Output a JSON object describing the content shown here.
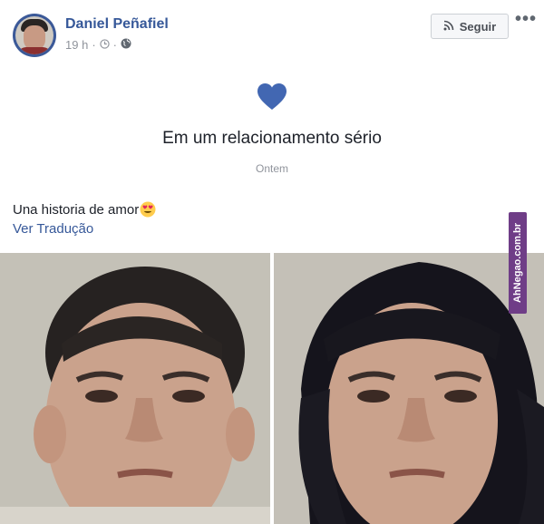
{
  "post": {
    "author": "Daniel Peñafiel",
    "time": "19 h",
    "meta_sep": "·",
    "follow_label": "Seguir",
    "more_label": "•••"
  },
  "life_event": {
    "title": "Em um relacionamento sério",
    "date": "Ontem",
    "heart_color": "#4267b2"
  },
  "caption": {
    "text": "Una historia de amor",
    "emoji": "heart-eyes-emoji",
    "translate": "Ver Tradução"
  },
  "watermark": "AhNegao.com.br",
  "colors": {
    "link": "#365899",
    "muted": "#90949c",
    "text": "#1d2129"
  },
  "photos": [
    {
      "name": "photo-boy",
      "description_icon": "photo"
    },
    {
      "name": "photo-boy-long-hair",
      "description_icon": "photo"
    }
  ]
}
